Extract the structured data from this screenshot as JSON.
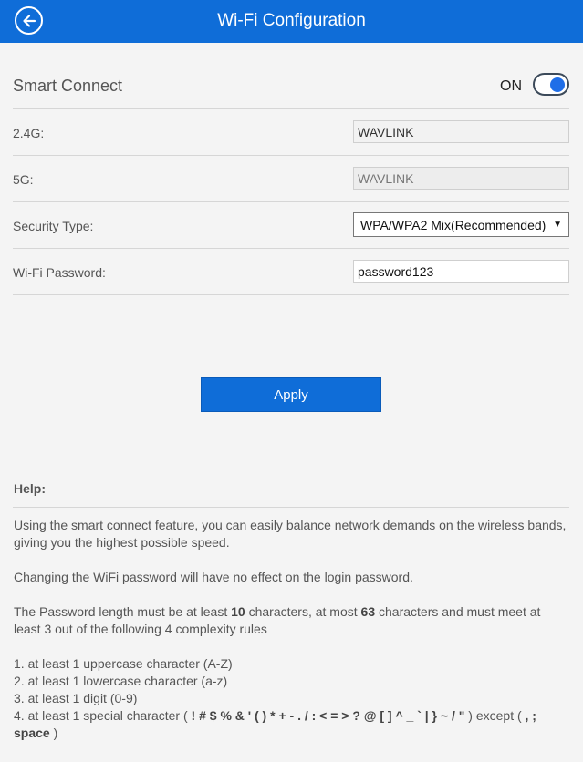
{
  "header": {
    "title": "Wi-Fi Configuration",
    "back_icon": "back-arrow-icon",
    "background": "#0f6dd8"
  },
  "smart_connect": {
    "label": "Smart Connect",
    "state_label": "ON",
    "enabled": true
  },
  "fields": {
    "band_24g": {
      "label": "2.4G:",
      "value": "WAVLINK"
    },
    "band_5g": {
      "label": "5G:",
      "value": "WAVLINK"
    },
    "security_type": {
      "label": "Security Type:",
      "selected": "WPA/WPA2 Mix(Recommended)"
    },
    "wifi_password": {
      "label": "Wi-Fi Password:",
      "value": "password123"
    }
  },
  "apply_label": "Apply",
  "help": {
    "title": "Help:",
    "p1": "Using the smart connect feature, you can easily balance network demands on the wireless bands, giving you the highest possible speed.",
    "p2": "Changing the WiFi password will have no effect on the login password.",
    "p3_pre": "The Password length must be at least ",
    "p3_min": "10",
    "p3_mid": " characters, at most ",
    "p3_max": "63",
    "p3_post": " characters and must meet at least 3 out of the following 4 complexity rules",
    "rules": [
      "1. at least 1 uppercase character (A-Z)",
      "2. at least 1 lowercase character (a-z)",
      "3. at least 1 digit (0-9)"
    ],
    "rule4_pre": "4. at least 1 special character ( ",
    "rule4_chars": "! # $ % & ' ( ) * + - . / : < = > ? @ [ ] ^ _ ` | } ~ / \"",
    "rule4_mid": " ) except ( ",
    "rule4_except": ", ; space",
    "rule4_post": " )"
  }
}
